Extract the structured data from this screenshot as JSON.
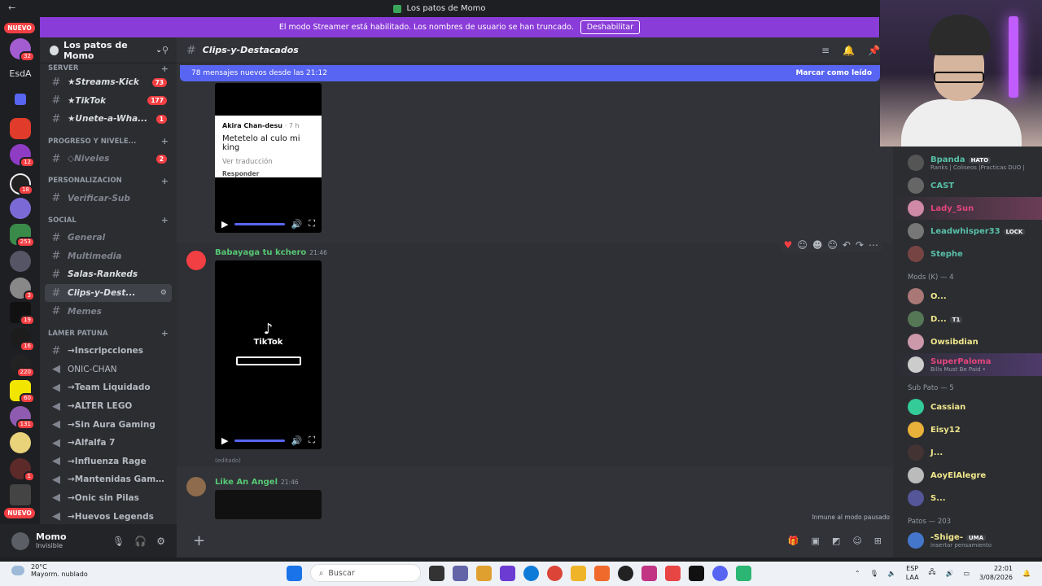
{
  "window": {
    "title": "Los patos de Momo"
  },
  "banner": {
    "text": "El modo Streamer está habilitado. Los nombres de usuario se han truncado.",
    "button": "Deshabilitar"
  },
  "rail": {
    "nuevo_top": "NUEVO",
    "esda": "EsdA",
    "nuevo_bottom": "NUEVO",
    "badges": [
      "32",
      "12",
      "18",
      "253",
      "3",
      "19",
      "16",
      "220",
      "60",
      "131",
      "1"
    ]
  },
  "guild": {
    "name": "Los patos de Momo"
  },
  "channels": {
    "cat_server": "SERVER",
    "streams": {
      "name": "★Streams-Kick",
      "count": "73"
    },
    "tiktok": {
      "name": "★TikTok",
      "count": "177"
    },
    "unete": {
      "name": "★Unete-a-Wha...",
      "count": "1"
    },
    "cat_progreso": "PROGRESO Y NIVELE...",
    "niveles": {
      "name": "◇Niveles",
      "count": "2"
    },
    "cat_personal": "PERSONALIZACION",
    "verificar": "Verificar-Sub",
    "cat_social": "SOCIAL",
    "general": "General",
    "multimedia": "Multimedia",
    "salas": "Salas-Rankeds",
    "clips": "Clips-y-Dest...",
    "memes": "Memes",
    "cat_lamer": "LAMER PATUNA",
    "voice": [
      "→Inscripcciones",
      "ONIC-CHAN",
      "→Team Liquidado",
      "→ALTER LEGO",
      "→Sin Aura Gaming",
      "→Alfalfa 7",
      "→Influenza Rage",
      "→Mantenidas Gaming",
      "→Onic sin Pilas",
      "→Huevos Legends"
    ]
  },
  "user": {
    "name": "Momo",
    "status": "Invisible"
  },
  "chat": {
    "channel": "Clips-y-Destacados",
    "newbar": "78 mensajes nuevos desde las 21:12",
    "mark_read": "Marcar como leído",
    "tt_card": {
      "user": "Akira Chan-desu",
      "ago": "· 7 h",
      "msg": "Metetelo al culo mi king",
      "translate": "Ver traducción",
      "reply": "Responder"
    },
    "msg1": {
      "author": "Babayaga tu kchero",
      "time": "21:46",
      "brand": "TikTok"
    },
    "edited": "(editado)",
    "msg2": {
      "author": "Like An Angel",
      "time": "21:46"
    },
    "immune": "Inmune al modo pausado"
  },
  "members": {
    "top": [
      {
        "name": "Bpanda",
        "tag": "HATO",
        "sub": "Ranks | Coliseos |Practicas DUO |",
        "color": "#58c0a8"
      },
      {
        "name": "CAST",
        "color": "#58c0a8"
      },
      {
        "name": "Lady_Sun",
        "color": "#e2467c"
      },
      {
        "name": "Leadwhisper33",
        "tag": "LOCK",
        "color": "#58c0a8"
      },
      {
        "name": "Stephe",
        "color": "#58c0a8"
      }
    ],
    "mods_label": "Mods (K) — 4",
    "mods": [
      {
        "name": "O...",
        "color": "#f0e68c"
      },
      {
        "name": "D...",
        "tag": "T1",
        "color": "#f0e68c"
      },
      {
        "name": "Owsibdian",
        "color": "#f0e68c"
      },
      {
        "name": "SuperPaloma",
        "sub": "Bills Must Be Paid •",
        "color": "#e2467c"
      }
    ],
    "sub_label": "Sub Pato — 5",
    "subs": [
      {
        "name": "Cassian",
        "color": "#f0e68c"
      },
      {
        "name": "Eisy12",
        "color": "#f0e68c"
      },
      {
        "name": "J...",
        "color": "#f0e68c"
      },
      {
        "name": "AoyElAlegre",
        "color": "#f0e68c"
      },
      {
        "name": "S...",
        "color": "#f0e68c"
      }
    ],
    "patos_label": "Patos — 203",
    "patos": [
      {
        "name": "-Shige-",
        "tag": "UMA",
        "sub": "insertar pensamiento",
        "color": "#f0e68c"
      }
    ]
  },
  "taskbar": {
    "temp": "20°C",
    "weather": "Mayorm. nublado",
    "search": "Buscar",
    "lang1": "ESP",
    "lang2": "LAA",
    "time": "22:01",
    "date": "3/08/2026"
  }
}
